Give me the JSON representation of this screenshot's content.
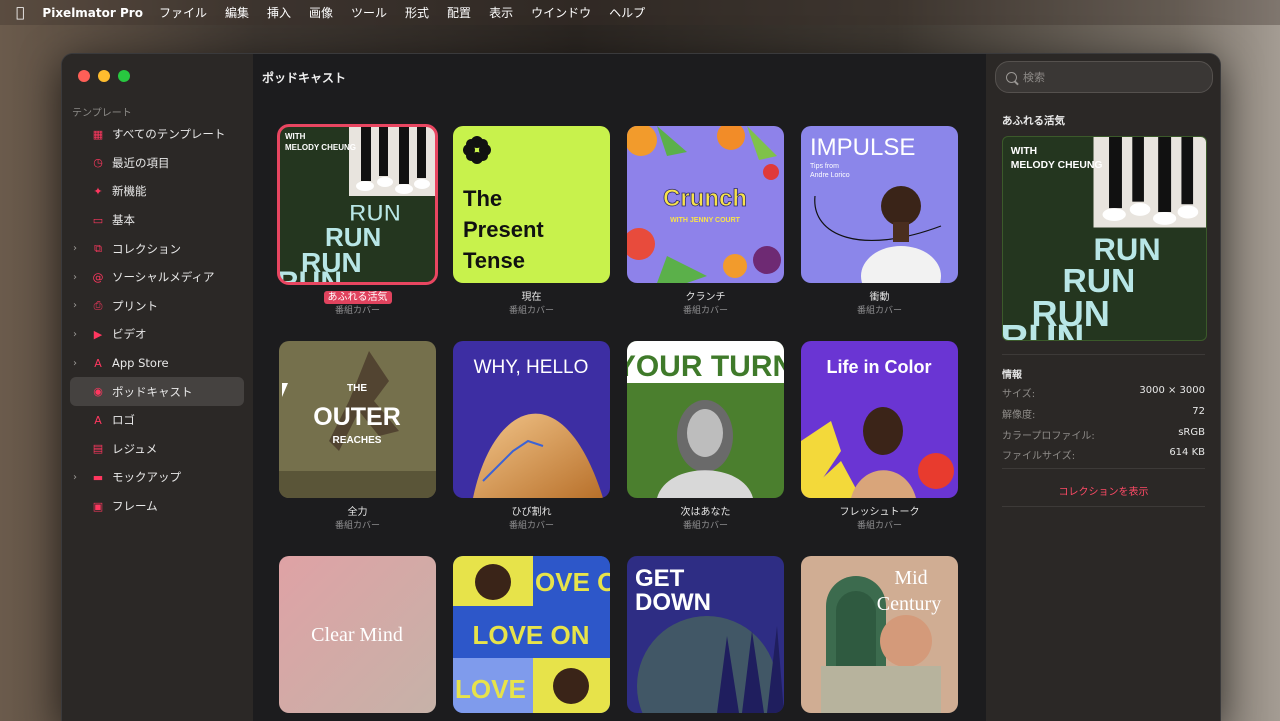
{
  "menubar": {
    "apple": "",
    "app_name": "Pixelmator Pro",
    "menus": [
      "ファイル",
      "編集",
      "挿入",
      "画像",
      "ツール",
      "形式",
      "配置",
      "表示",
      "ウインドウ",
      "ヘルプ"
    ]
  },
  "sidebar": {
    "section_label": "テンプレート",
    "items": [
      {
        "label": "すべてのテンプレート",
        "icon": "grid-icon",
        "chevron": false
      },
      {
        "label": "最近の項目",
        "icon": "clock-icon",
        "chevron": false
      },
      {
        "label": "新機能",
        "icon": "sparkle-icon",
        "chevron": false
      },
      {
        "label": "基本",
        "icon": "document-icon",
        "chevron": false
      },
      {
        "label": "コレクション",
        "icon": "collection-icon",
        "chevron": true
      },
      {
        "label": "ソーシャルメディア",
        "icon": "at-icon",
        "chevron": true
      },
      {
        "label": "プリント",
        "icon": "printer-icon",
        "chevron": true
      },
      {
        "label": "ビデオ",
        "icon": "video-icon",
        "chevron": true
      },
      {
        "label": "App Store",
        "icon": "app-store-icon",
        "chevron": true
      },
      {
        "label": "ポッドキャスト",
        "icon": "podcast-icon",
        "chevron": false,
        "active": true
      },
      {
        "label": "ロゴ",
        "icon": "logo-a-icon",
        "chevron": false
      },
      {
        "label": "レジュメ",
        "icon": "resume-icon",
        "chevron": false
      },
      {
        "label": "モックアップ",
        "icon": "mockup-icon",
        "chevron": true
      },
      {
        "label": "フレーム",
        "icon": "frame-icon",
        "chevron": false
      }
    ]
  },
  "main": {
    "title": "ポッドキャスト",
    "templates": [
      {
        "name": "あふれる活気",
        "sub": "番組カバー",
        "selected": true,
        "art": [
          "WITH",
          "MELODY CHEUNG",
          "RUN"
        ]
      },
      {
        "name": "現在",
        "sub": "番組カバー",
        "art": [
          "The",
          "Present",
          "Tense"
        ]
      },
      {
        "name": "クランチ",
        "sub": "番組カバー",
        "art": [
          "Crunch",
          "WITH JENNY COURT"
        ]
      },
      {
        "name": "衝動",
        "sub": "番組カバー",
        "art": [
          "IMPULSE",
          "Tips from",
          "Andre Lorico"
        ]
      },
      {
        "name": "全力",
        "sub": "番組カバー",
        "art": [
          "THE",
          "OUTER",
          "REACHES"
        ]
      },
      {
        "name": "ひび割れ",
        "sub": "番組カバー",
        "art": [
          "WHY, HELLO"
        ]
      },
      {
        "name": "次はあなた",
        "sub": "番組カバー",
        "art": [
          "YOUR TURN"
        ]
      },
      {
        "name": "フレッシュトーク",
        "sub": "番組カバー",
        "art": [
          "Life in Color"
        ]
      },
      {
        "name": "",
        "sub": "",
        "art": [
          "Clear Mind"
        ]
      },
      {
        "name": "",
        "sub": "",
        "art": [
          "LOVE ON",
          "OVE ON",
          "LOVE O"
        ]
      },
      {
        "name": "",
        "sub": "",
        "art": [
          "GET",
          "DOWN"
        ]
      },
      {
        "name": "",
        "sub": "",
        "art": [
          "Mid",
          "Century"
        ]
      }
    ]
  },
  "inspector": {
    "search_placeholder": "検索",
    "selected_title": "あふれる活気",
    "info_heading": "情報",
    "rows": [
      {
        "key": "サイズ:",
        "value": "3000 × 3000"
      },
      {
        "key": "解像度:",
        "value": "72"
      },
      {
        "key": "カラープロファイル:",
        "value": "sRGB"
      },
      {
        "key": "ファイルサイズ:",
        "value": "614 KB"
      }
    ],
    "collection_link": "コレクションを表示"
  },
  "colors": {
    "accent": "#ff375f",
    "selection": "#e84661",
    "traffic_red": "#ff5f57",
    "traffic_yellow": "#febc2e",
    "traffic_green": "#28c840"
  }
}
